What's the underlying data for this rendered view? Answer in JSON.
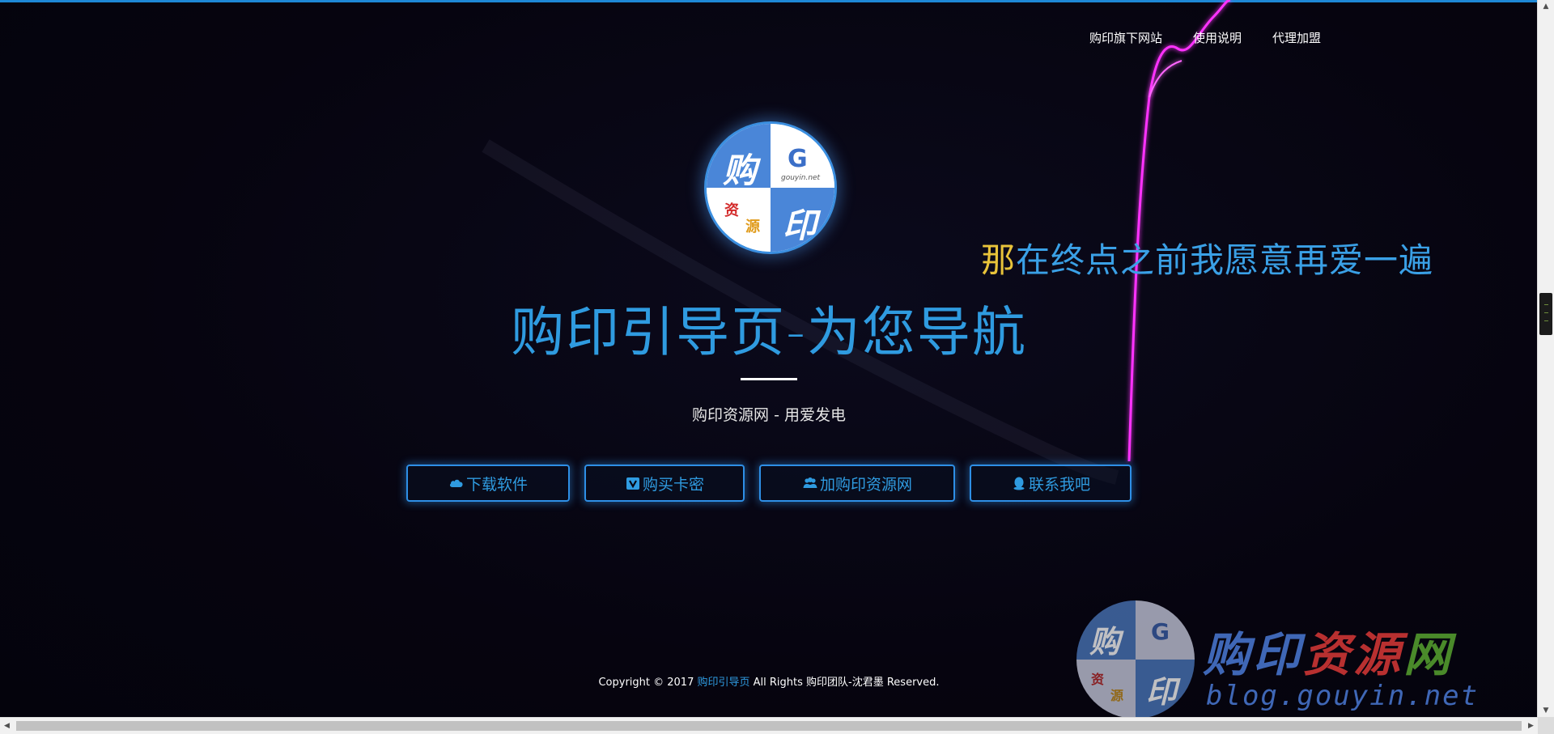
{
  "nav": {
    "items": [
      "购印旗下网站",
      "使用说明",
      "代理加盟"
    ]
  },
  "logo": {
    "gou": "购",
    "g": "G",
    "site": "gouyin.net",
    "zi": "资",
    "yuan": "源",
    "yin": "印"
  },
  "lyric": {
    "first_char": "那",
    "rest": "在终点之前我愿意再爱一遍"
  },
  "hero": {
    "title": "购印引导页-为您导航",
    "subtitle": "购印资源网 - 用爱发电"
  },
  "buttons": [
    {
      "label": "下载软件",
      "icon": "cloud-icon"
    },
    {
      "label": "购买卡密",
      "icon": "v-square-icon"
    },
    {
      "label": "加购印资源网",
      "icon": "users-icon"
    },
    {
      "label": "联系我吧",
      "icon": "qq-icon"
    }
  ],
  "footer": {
    "prefix": "Copyright © 2017 ",
    "link": "购印引导页",
    "suffix": " All Rights 购印团队-沈君墨 Reserved."
  },
  "watermark": {
    "gou": "购",
    "g": "G",
    "zi": "资",
    "yuan": "源",
    "yin": "印",
    "name": [
      "购",
      "印",
      "资",
      "源",
      "网"
    ],
    "url": "blog.gouyin.net"
  },
  "colors": {
    "background": "#05030f",
    "accent": "#2f9be0",
    "streak": "#ff33ff"
  }
}
